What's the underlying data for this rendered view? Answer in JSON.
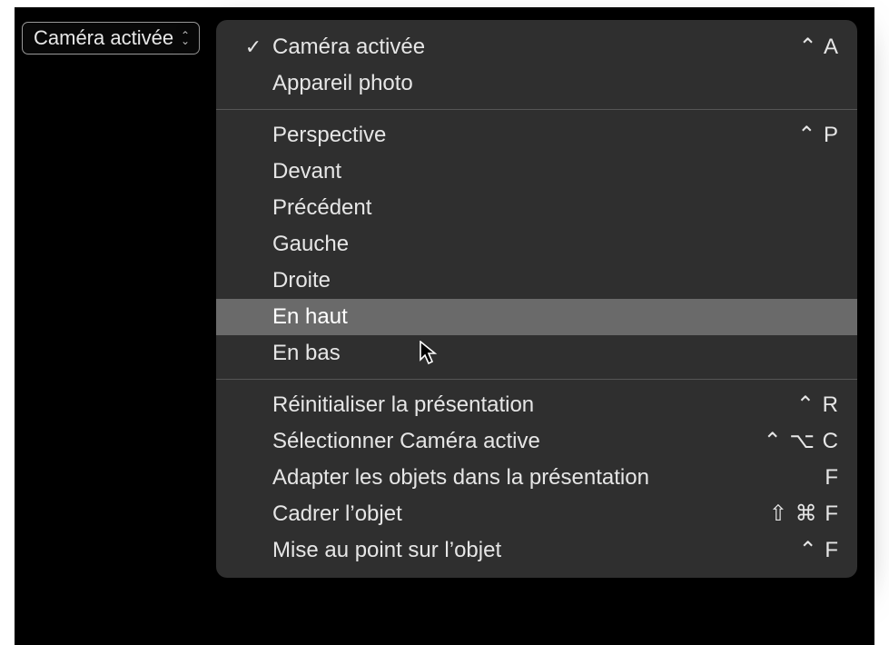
{
  "trigger": {
    "label": "Caméra activée"
  },
  "menu": {
    "sections": [
      [
        {
          "checked": true,
          "label": "Caméra activée",
          "shortcut": "⌃ A"
        },
        {
          "checked": false,
          "label": "Appareil photo",
          "shortcut": ""
        }
      ],
      [
        {
          "checked": false,
          "label": "Perspective",
          "shortcut": "⌃ P"
        },
        {
          "checked": false,
          "label": "Devant",
          "shortcut": ""
        },
        {
          "checked": false,
          "label": "Précédent",
          "shortcut": ""
        },
        {
          "checked": false,
          "label": "Gauche",
          "shortcut": ""
        },
        {
          "checked": false,
          "label": "Droite",
          "shortcut": ""
        },
        {
          "checked": false,
          "label": "En haut",
          "shortcut": "",
          "highlight": true
        },
        {
          "checked": false,
          "label": "En bas",
          "shortcut": ""
        }
      ],
      [
        {
          "checked": false,
          "label": "Réinitialiser la présentation",
          "shortcut": "⌃ R"
        },
        {
          "checked": false,
          "label": "Sélectionner Caméra active",
          "shortcut": "⌃ ⌥ C"
        },
        {
          "checked": false,
          "label": "Adapter les objets dans la présentation",
          "shortcut": "F"
        },
        {
          "checked": false,
          "label": "Cadrer l’objet",
          "shortcut": "⇧ ⌘ F"
        },
        {
          "checked": false,
          "label": "Mise au point sur l’objet",
          "shortcut": "⌃ F"
        }
      ]
    ]
  }
}
